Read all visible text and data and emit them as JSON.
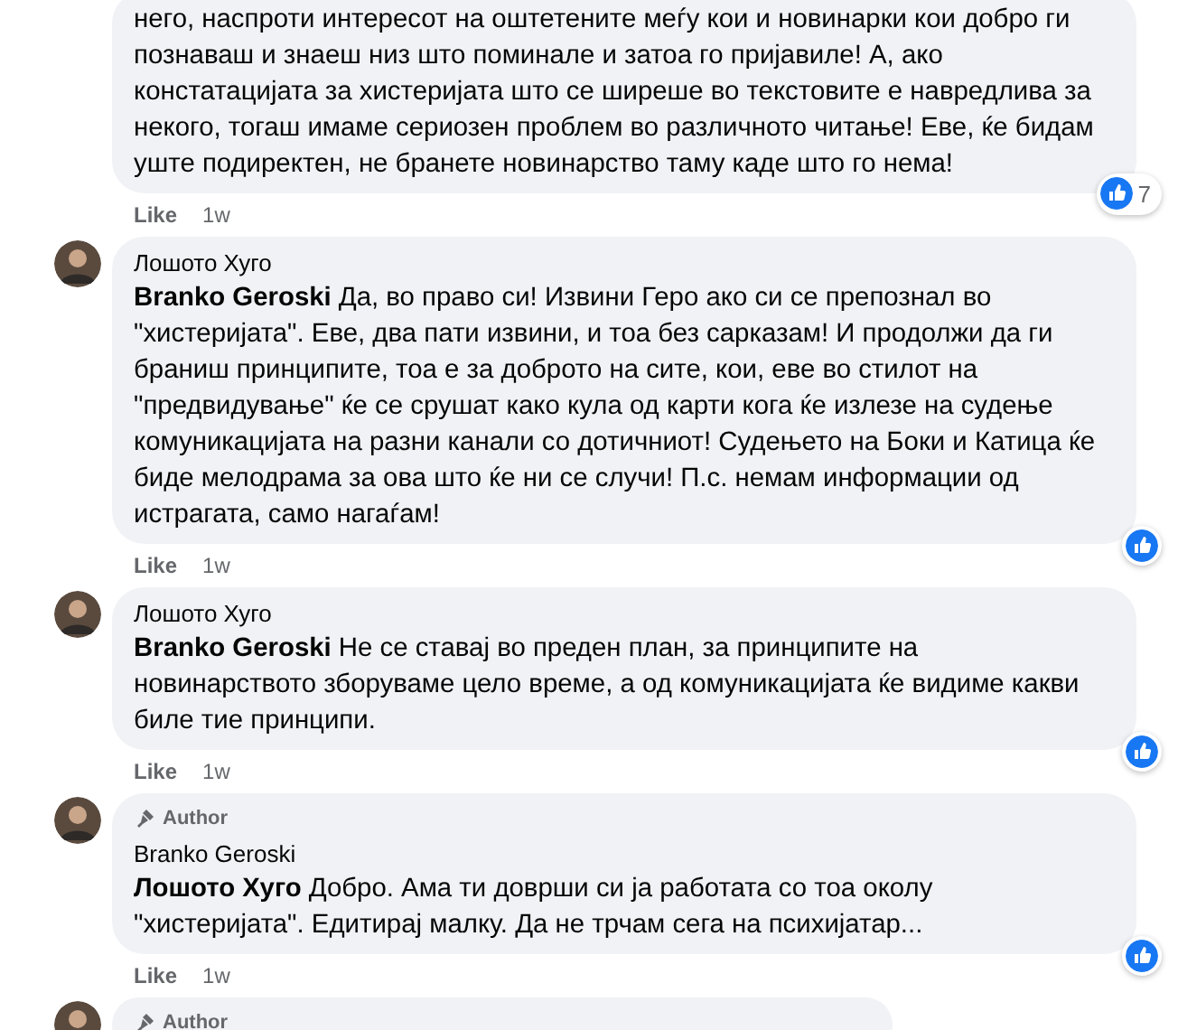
{
  "comments": [
    {
      "text": "него, наспроти интересот на оштетените меѓу кои и новинарки кои добро ги познаваш и знаеш низ што поминале и затоа го пријавиле! А, ако констатацијата за хистеријата што се ширеше во текстовите е навредлива за некого, тогаш имаме сериозен проблем во различното читање! Еве, ќе бидам уште подиректен, не бранете новинарство таму каде што го нема!",
      "like": "Like",
      "time": "1w",
      "reaction_count": "7"
    },
    {
      "author": "Лошото Хуго",
      "mention": "Branko Geroski",
      "text": "Да, во право си! Извини Геро ако си се препознал во \"хистеријата\". Еве, два пати извини, и тоа без сарказам! И продолжи да ги браниш принципите, тоа е за доброто на сите, кои, еве во стилот на \"предвидување\" ќе се срушат како кула од карти кога ќе излезе на судење комуникацијата на разни канали со дотичниот! Судењето на Боки и Катица ќе биде мелодрама за ова што ќе ни се случи! П.с. немам информации од истрагата, само нагаѓам!",
      "like": "Like",
      "time": "1w"
    },
    {
      "author": "Лошото Хуго",
      "mention": "Branko Geroski",
      "text": "Не се ставај во преден план, за принципите на новинарството зборуваме цело време, а од комуникацијата ќе видиме какви биле тие принципи.",
      "like": "Like",
      "time": "1w"
    },
    {
      "badge": "Author",
      "author": "Branko Geroski",
      "mention": "Лошото Хуго",
      "text": "Добро. Ама ти доврши си ја работата со тоа околу \"хистеријата\". Едитирај малку. Да не трчам сега на психијатар...",
      "like": "Like",
      "time": "1w"
    },
    {
      "badge": "Author"
    }
  ]
}
